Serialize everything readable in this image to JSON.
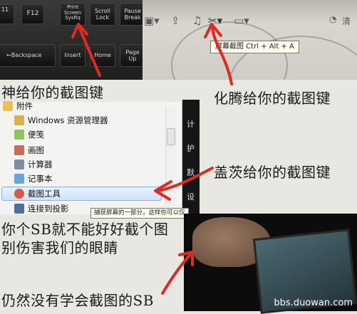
{
  "keyboard": {
    "keys": [
      {
        "label": "11"
      },
      {
        "label": "F12"
      },
      {
        "label": "Print\nScreen\nSysRq"
      },
      {
        "label": "Scroll\nLock"
      },
      {
        "label": "Pause\nBreak"
      },
      {
        "label": "←Backspace"
      },
      {
        "label": "Insert"
      },
      {
        "label": "Home"
      },
      {
        "label": "Page\nUp"
      }
    ]
  },
  "toolbar": {
    "tooltip": "屏幕截图 Ctrl + Alt + A",
    "right_label": "清"
  },
  "captions": {
    "top_left": "神给你的截图键",
    "top_right": "化腾给你的截图键",
    "middle_right": "盖茨给你的截图键",
    "middle_left_1": "你个SB就不能好好截个图",
    "middle_left_2": "别伤害我们的眼睛",
    "bottom_left": "仍然没有学会截图的SB"
  },
  "start_menu": {
    "folder": "附件",
    "items": [
      {
        "label": "Windows 资源管理器"
      },
      {
        "label": "便笺"
      },
      {
        "label": "画图"
      },
      {
        "label": "计算器"
      },
      {
        "label": "记事本"
      },
      {
        "label": "截图工具"
      },
      {
        "label": "连接到投影"
      }
    ],
    "tooltip": "捕获屏幕的一部分，这样你可以仅",
    "dark_chars": [
      "计",
      "护",
      "默",
      "设"
    ]
  },
  "watermark": "bbs.duowan.com"
}
